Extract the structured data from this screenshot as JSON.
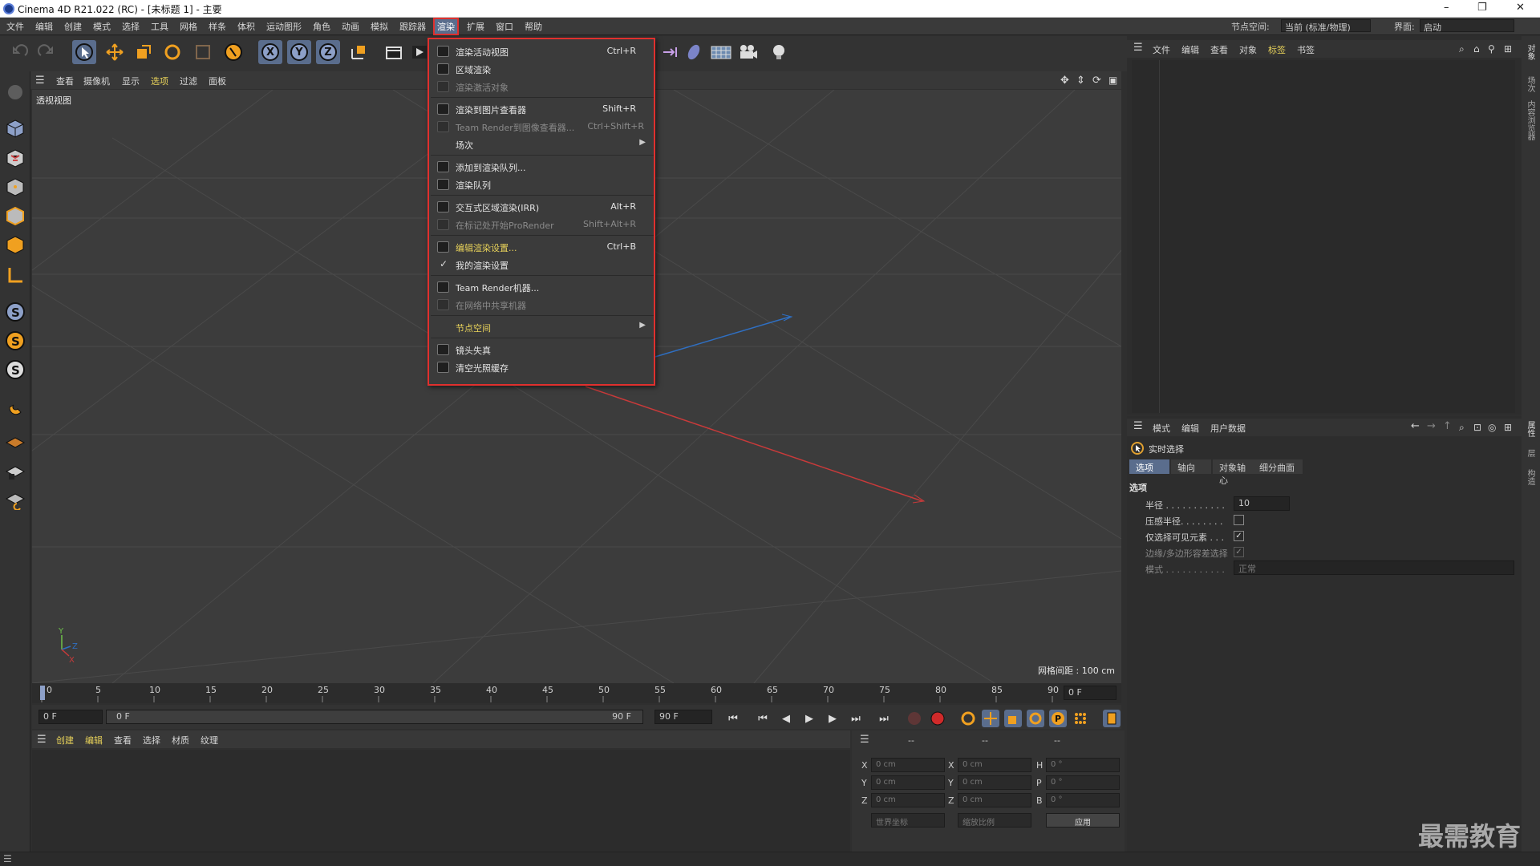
{
  "app": {
    "title": "Cinema 4D R21.022 (RC) - [未标题 1] - 主要",
    "window_controls": [
      "–",
      "❐",
      "✕"
    ]
  },
  "menubar": {
    "items": [
      "文件",
      "编辑",
      "创建",
      "模式",
      "选择",
      "工具",
      "网格",
      "样条",
      "体积",
      "运动图形",
      "角色",
      "动画",
      "模拟",
      "跟踪器",
      "渲染",
      "扩展",
      "窗口",
      "帮助"
    ],
    "active": "渲染",
    "node_space_label": "节点空间:",
    "node_space_value": "当前 (标准/物理)",
    "layout_label": "界面:",
    "layout_value": "启动"
  },
  "viewport": {
    "menu": [
      "查看",
      "摄像机",
      "显示",
      "选项",
      "过滤",
      "面板"
    ],
    "label": "透视视图",
    "grid_label": "网格间距 : 100 cm"
  },
  "render_menu": {
    "items": [
      {
        "label": "渲染活动视图",
        "shortcut": "Ctrl+R",
        "state": "normal"
      },
      {
        "label": "区域渲染",
        "shortcut": "",
        "state": "normal"
      },
      {
        "label": "渲染激活对象",
        "shortcut": "",
        "state": "disabled"
      },
      {
        "label": "渲染到图片查看器",
        "shortcut": "Shift+R",
        "state": "normal"
      },
      {
        "label": "Team Render到图像查看器...",
        "shortcut": "Ctrl+Shift+R",
        "state": "disabled"
      },
      {
        "label": "场次",
        "shortcut": "",
        "state": "submenu"
      },
      {
        "label": "添加到渲染队列...",
        "shortcut": "",
        "state": "normal"
      },
      {
        "label": "渲染队列",
        "shortcut": "",
        "state": "normal"
      },
      {
        "label": "交互式区域渲染(IRR)",
        "shortcut": "Alt+R",
        "state": "normal"
      },
      {
        "label": "在标记处开始ProRender",
        "shortcut": "Shift+Alt+R",
        "state": "disabled"
      },
      {
        "label": "编辑渲染设置...",
        "shortcut": "Ctrl+B",
        "state": "highlight"
      },
      {
        "label": "我的渲染设置",
        "shortcut": "",
        "state": "checked"
      },
      {
        "label": "Team Render机器...",
        "shortcut": "",
        "state": "normal"
      },
      {
        "label": "在网络中共享机器",
        "shortcut": "",
        "state": "disabled"
      },
      {
        "label": "节点空间",
        "shortcut": "",
        "state": "submenu-yellow"
      },
      {
        "label": "镜头失真",
        "shortcut": "",
        "state": "normal"
      },
      {
        "label": "清空光照缓存",
        "shortcut": "",
        "state": "normal"
      }
    ]
  },
  "timeline": {
    "ticks": [
      "0",
      "5",
      "10",
      "15",
      "20",
      "25",
      "30",
      "35",
      "40",
      "45",
      "50",
      "55",
      "60",
      "65",
      "70",
      "75",
      "80",
      "85",
      "90"
    ],
    "current_frame": "0 F",
    "start_field": "0 F",
    "range_start": "0 F",
    "range_end": "90 F",
    "end_field": "90 F"
  },
  "material": {
    "menu": [
      "创建",
      "编辑",
      "查看",
      "选择",
      "材质",
      "纹理"
    ]
  },
  "coordinates": {
    "header": [
      "--",
      "--",
      "--"
    ],
    "rows": [
      {
        "a": "X",
        "av": "0 cm",
        "b": "X",
        "bv": "0 cm",
        "c": "H",
        "cv": "0 °"
      },
      {
        "a": "Y",
        "av": "0 cm",
        "b": "Y",
        "bv": "0 cm",
        "c": "P",
        "cv": "0 °"
      },
      {
        "a": "Z",
        "av": "0 cm",
        "b": "Z",
        "bv": "0 cm",
        "c": "B",
        "cv": "0 °"
      }
    ],
    "world_dd": "世界坐标",
    "scale_dd": "缩放比例",
    "apply": "应用"
  },
  "object_manager": {
    "menu": [
      "文件",
      "编辑",
      "查看",
      "对象",
      "标签",
      "书签"
    ]
  },
  "attribute_manager": {
    "menu": [
      "模式",
      "编辑",
      "用户数据"
    ],
    "tool_name": "实时选择",
    "tabs": [
      "选项",
      "轴向",
      "对象轴心",
      "细分曲面"
    ],
    "section": "选项",
    "radius_label": "半径 . . . . . . . . . . .",
    "radius_value": "10",
    "pressure_label": "压感半径. . . . . . . .",
    "visible_only_label": "仅选择可见元素 . . .",
    "edge_label": "边缘/多边形容差选择",
    "mode_label": "模式 . . . . . . . . . . .",
    "mode_value": "正常"
  },
  "right_strip": [
    "对象",
    "场次",
    "内容浏览器",
    "属性",
    "层",
    "构造"
  ],
  "watermark": "最需教育"
}
